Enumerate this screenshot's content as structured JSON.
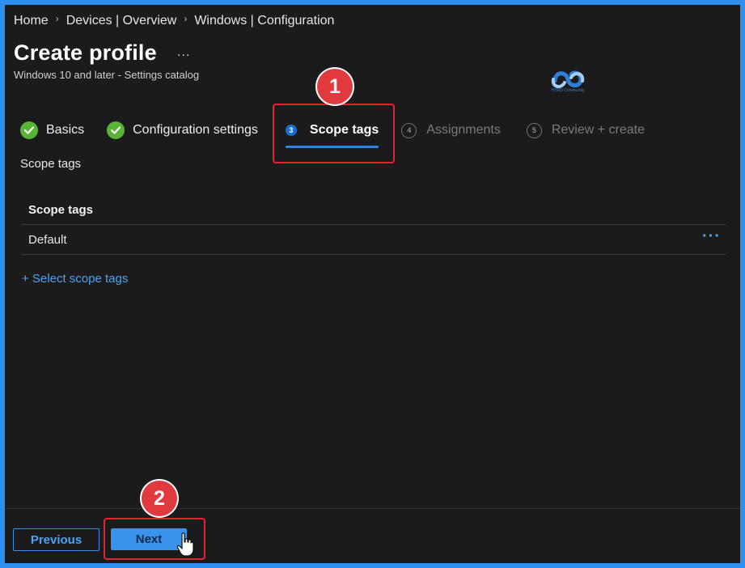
{
  "breadcrumb": [
    "Home",
    "Devices | Overview",
    "Windows | Configuration"
  ],
  "page": {
    "title": "Create profile",
    "more": "...",
    "subtitle": "Windows 10 and later - Settings catalog"
  },
  "logo": {
    "text": "HTMD Community"
  },
  "steps": [
    {
      "label": "Basics",
      "state": "done"
    },
    {
      "label": "Configuration settings",
      "state": "done"
    },
    {
      "number": "3",
      "label": "Scope tags",
      "state": "active"
    },
    {
      "number": "4",
      "label": "Assignments",
      "state": "disabled"
    },
    {
      "number": "5",
      "label": "Review + create",
      "state": "disabled"
    }
  ],
  "section_label": "Scope tags",
  "table": {
    "header": "Scope tags",
    "rows": [
      {
        "name": "Default",
        "menu": "···"
      }
    ]
  },
  "add_link": "+ Select scope tags",
  "footer": {
    "previous": "Previous",
    "next": "Next"
  },
  "annotations": {
    "badge1": "1",
    "badge2": "2"
  },
  "colors": {
    "accent": "#2b86e3",
    "highlight": "#e0262f",
    "check": "#58b435"
  }
}
